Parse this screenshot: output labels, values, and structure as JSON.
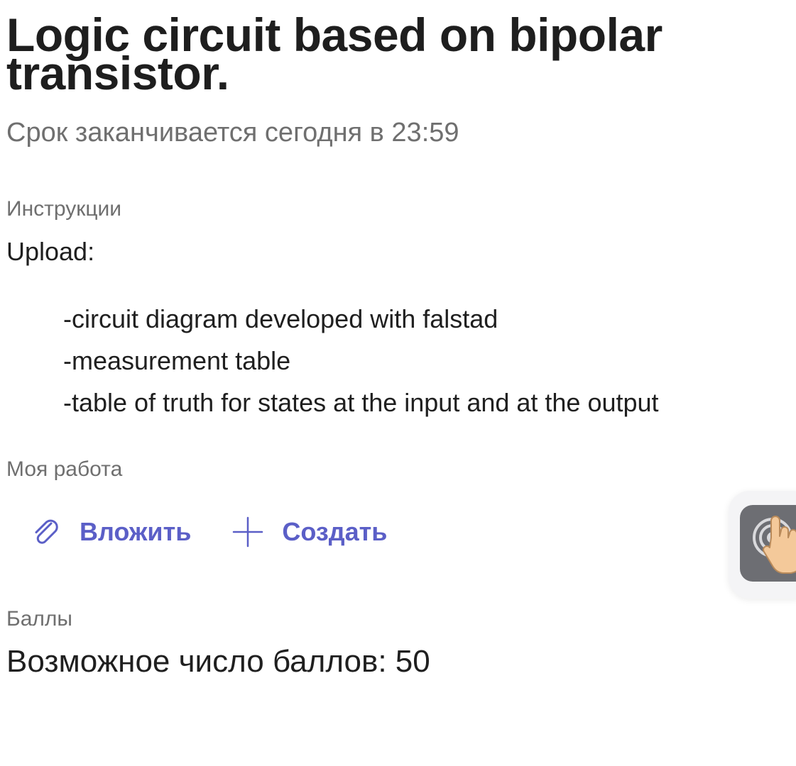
{
  "assignment": {
    "title": "Logic circuit based on bipolar transistor.",
    "deadline": "Срок заканчивается сегодня в 23:59"
  },
  "instructions": {
    "label": "Инструкции",
    "intro": "Upload:",
    "items": [
      "-circuit diagram developed with falstad",
      "-measurement table",
      "-table of truth for states at the input and at the output"
    ]
  },
  "my_work": {
    "label": "Моя работа",
    "attach_label": "Вложить",
    "attach_icon": "paperclip-icon",
    "create_label": "Создать",
    "create_icon": "plus-icon"
  },
  "points": {
    "label": "Баллы",
    "value": "Возможное число баллов: 50"
  },
  "floating_button": {
    "icon": "touch-gesture-icon"
  },
  "colors": {
    "accent": "#5b5fc7",
    "secondary_text": "#6f6f6f",
    "primary_text": "#1f1f1f"
  }
}
